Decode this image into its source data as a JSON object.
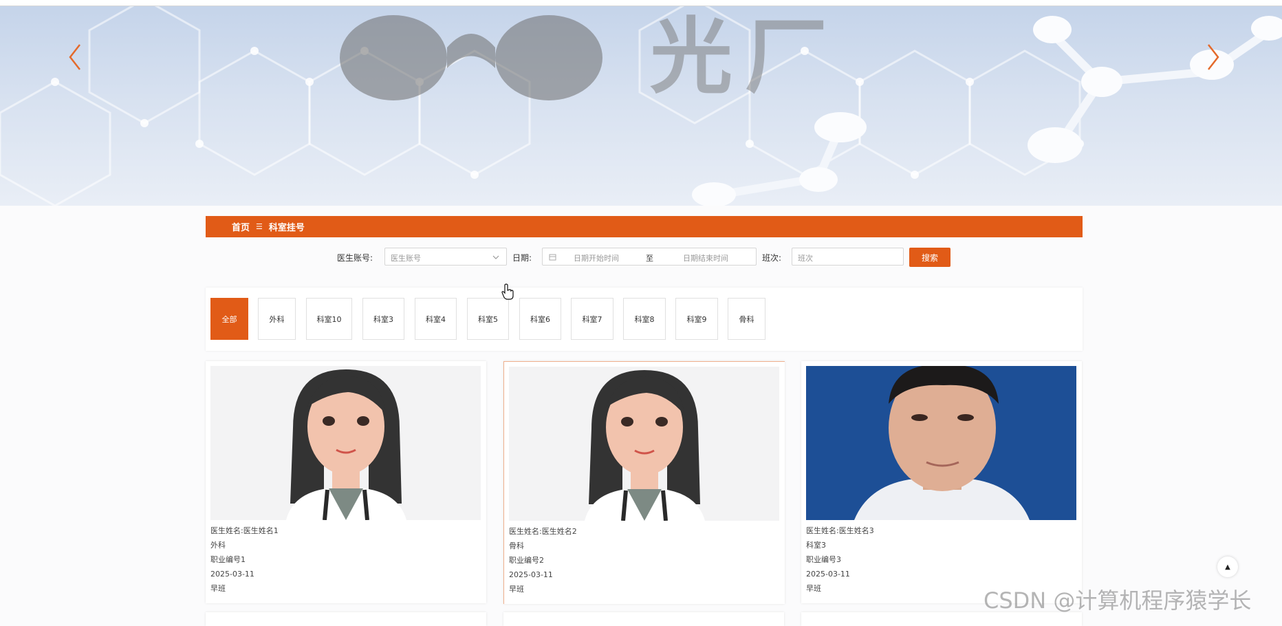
{
  "banner": {
    "logo_text": "光厂"
  },
  "breadcrumb": {
    "home": "首页",
    "separator": "☰",
    "current": "科室挂号"
  },
  "search": {
    "doctor_account_label": "医生账号:",
    "doctor_account_placeholder": "医生账号",
    "date_label": "日期:",
    "date_start_placeholder": "日期开始时间",
    "date_to": "至",
    "date_end_placeholder": "日期结束时间",
    "shift_label": "班次:",
    "shift_placeholder": "班次",
    "search_button": "搜索"
  },
  "tabs": [
    "全部",
    "外科",
    "科室10",
    "科室3",
    "科室4",
    "科室5",
    "科室6",
    "科室7",
    "科室8",
    "科室9",
    "骨科"
  ],
  "active_tab": "全部",
  "cards": [
    {
      "name_label": "医生姓名:",
      "name": "医生姓名1",
      "department": "外科",
      "job_no": "职业编号1",
      "date": "2025-03-11",
      "shift": "早班",
      "photo": "cartoon-female-doctor"
    },
    {
      "name_label": "医生姓名:",
      "name": "医生姓名2",
      "department": "骨科",
      "job_no": "职业编号2",
      "date": "2025-03-11",
      "shift": "早班",
      "photo": "cartoon-female-doctor"
    },
    {
      "name_label": "医生姓名:",
      "name": "医生姓名3",
      "department": "科室3",
      "job_no": "职业编号3",
      "date": "2025-03-11",
      "shift": "早班",
      "photo": "male-doctor-photo"
    }
  ],
  "back_to_top": "▲",
  "watermark": "CSDN @计算机程序猿学长",
  "colors": {
    "accent": "#e15b17"
  }
}
